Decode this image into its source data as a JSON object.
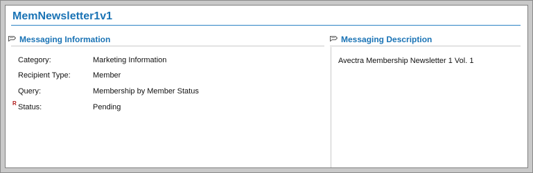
{
  "page": {
    "title": "MemNewsletter1v1"
  },
  "messaging_information": {
    "heading": "Messaging Information",
    "icon": "note-icon",
    "fields": [
      {
        "label": "Category:",
        "value": "Marketing Information",
        "required": false
      },
      {
        "label": "Recipient Type:",
        "value": "Member",
        "required": false
      },
      {
        "label": "Query:",
        "value": "Membership by Member Status",
        "required": false
      },
      {
        "label": "Status:",
        "value": "Pending",
        "required": true,
        "required_marker": "R"
      }
    ]
  },
  "messaging_description": {
    "heading": "Messaging Description",
    "icon": "note-icon",
    "text": "Avectra Membership Newsletter 1 Vol. 1"
  },
  "colors": {
    "accent": "#1a73b5",
    "required_marker": "#b01919"
  }
}
